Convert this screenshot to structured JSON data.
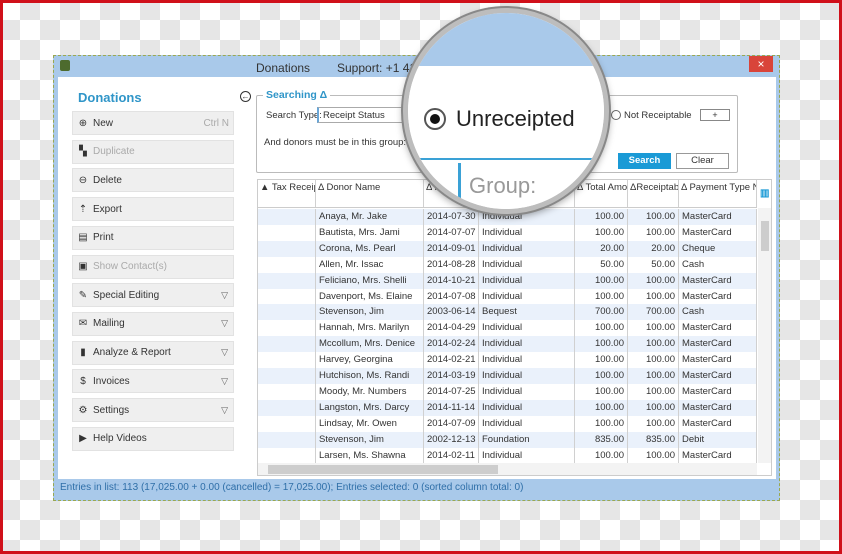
{
  "window": {
    "title": "Donations",
    "support": "Support: +1 41",
    "close": "×"
  },
  "sidebar": {
    "heading": "Donations",
    "items": [
      {
        "label": "New",
        "icon": "plus-circle-icon",
        "glyph": "⊕",
        "shortcut": "Ctrl N",
        "disabled": false,
        "menu": false
      },
      {
        "label": "Duplicate",
        "icon": "duplicate-icon",
        "glyph": "▚",
        "disabled": true,
        "menu": false
      },
      {
        "label": "Delete",
        "icon": "minus-circle-icon",
        "glyph": "⊖",
        "disabled": false,
        "menu": false
      },
      {
        "label": "Export",
        "icon": "export-icon",
        "glyph": "⇡",
        "disabled": false,
        "menu": false
      },
      {
        "label": "Print",
        "icon": "print-icon",
        "glyph": "▤",
        "disabled": false,
        "menu": false
      },
      {
        "label": "Show Contact(s)",
        "icon": "contact-icon",
        "glyph": "▣",
        "disabled": true,
        "menu": false
      },
      {
        "label": "Special Editing",
        "icon": "edit-icon",
        "glyph": "✎",
        "disabled": false,
        "menu": true
      },
      {
        "label": "Mailing",
        "icon": "mail-icon",
        "glyph": "✉",
        "disabled": false,
        "menu": true
      },
      {
        "label": "Analyze & Report",
        "icon": "chart-icon",
        "glyph": "▮",
        "disabled": false,
        "menu": true
      },
      {
        "label": "Invoices",
        "icon": "invoice-icon",
        "glyph": "$",
        "disabled": false,
        "menu": true
      },
      {
        "label": "Settings",
        "icon": "gear-icon",
        "glyph": "⚙",
        "disabled": false,
        "menu": true
      },
      {
        "label": "Help Videos",
        "icon": "video-icon",
        "glyph": "▶",
        "disabled": false,
        "menu": false
      }
    ]
  },
  "search": {
    "title": "Searching Δ",
    "type_label": "Search Type:",
    "type_value": "Receipt Status",
    "group_label": "And donors must be in this group:",
    "radio_selected": "Unreceipted",
    "radio_other": "Not Receiptable",
    "plus": "+",
    "search_btn": "Search",
    "clear_btn": "Clear"
  },
  "magnifier": {
    "radio": "Unreceipted",
    "group": "Group:"
  },
  "table": {
    "headers": [
      "▲ Tax Receipt Nu...",
      "Δ Donor Name",
      "Δ Recei...",
      "",
      "Δ Total Amount",
      "ΔReceiptable Amount",
      "Δ Payment Type Name"
    ],
    "rows": [
      [
        "",
        "Anaya, Mr. Jake",
        "2014-07-30",
        "Individual",
        "100.00",
        "100.00",
        "MasterCard"
      ],
      [
        "",
        "Bautista, Mrs. Jami",
        "2014-07-07",
        "Individual",
        "100.00",
        "100.00",
        "MasterCard"
      ],
      [
        "",
        "Corona, Ms. Pearl",
        "2014-09-01",
        "Individual",
        "20.00",
        "20.00",
        "Cheque"
      ],
      [
        "",
        "Allen, Mr. Issac",
        "2014-08-28",
        "Individual",
        "50.00",
        "50.00",
        "Cash"
      ],
      [
        "",
        "Feliciano, Mrs. Shelli",
        "2014-10-21",
        "Individual",
        "100.00",
        "100.00",
        "MasterCard"
      ],
      [
        "",
        "Davenport, Ms. Elaine",
        "2014-07-08",
        "Individual",
        "100.00",
        "100.00",
        "MasterCard"
      ],
      [
        "",
        "Stevenson, Jim",
        "2003-06-14",
        "Bequest",
        "700.00",
        "700.00",
        "Cash"
      ],
      [
        "",
        "Hannah, Mrs. Marilyn",
        "2014-04-29",
        "Individual",
        "100.00",
        "100.00",
        "MasterCard"
      ],
      [
        "",
        "Mccollum, Mrs. Denice",
        "2014-02-24",
        "Individual",
        "100.00",
        "100.00",
        "MasterCard"
      ],
      [
        "",
        "Harvey, Georgina",
        "2014-02-21",
        "Individual",
        "100.00",
        "100.00",
        "MasterCard"
      ],
      [
        "",
        "Hutchison, Ms. Randi",
        "2014-03-19",
        "Individual",
        "100.00",
        "100.00",
        "MasterCard"
      ],
      [
        "",
        "Moody, Mr. Numbers",
        "2014-07-25",
        "Individual",
        "100.00",
        "100.00",
        "MasterCard"
      ],
      [
        "",
        "Langston, Mrs. Darcy",
        "2014-11-14",
        "Individual",
        "100.00",
        "100.00",
        "MasterCard"
      ],
      [
        "",
        "Lindsay, Mr. Owen",
        "2014-07-09",
        "Individual",
        "100.00",
        "100.00",
        "MasterCard"
      ],
      [
        "",
        "Stevenson, Jim",
        "2002-12-13",
        "Foundation",
        "835.00",
        "835.00",
        "Debit"
      ],
      [
        "",
        "Larsen, Ms. Shawna",
        "2014-02-11",
        "Individual",
        "100.00",
        "100.00",
        "MasterCard"
      ]
    ]
  },
  "status": "Entries in list: 113 (17,025.00 + 0.00 (cancelled) = 17,025.00); Entries selected: 0  (sorted column total: 0)"
}
